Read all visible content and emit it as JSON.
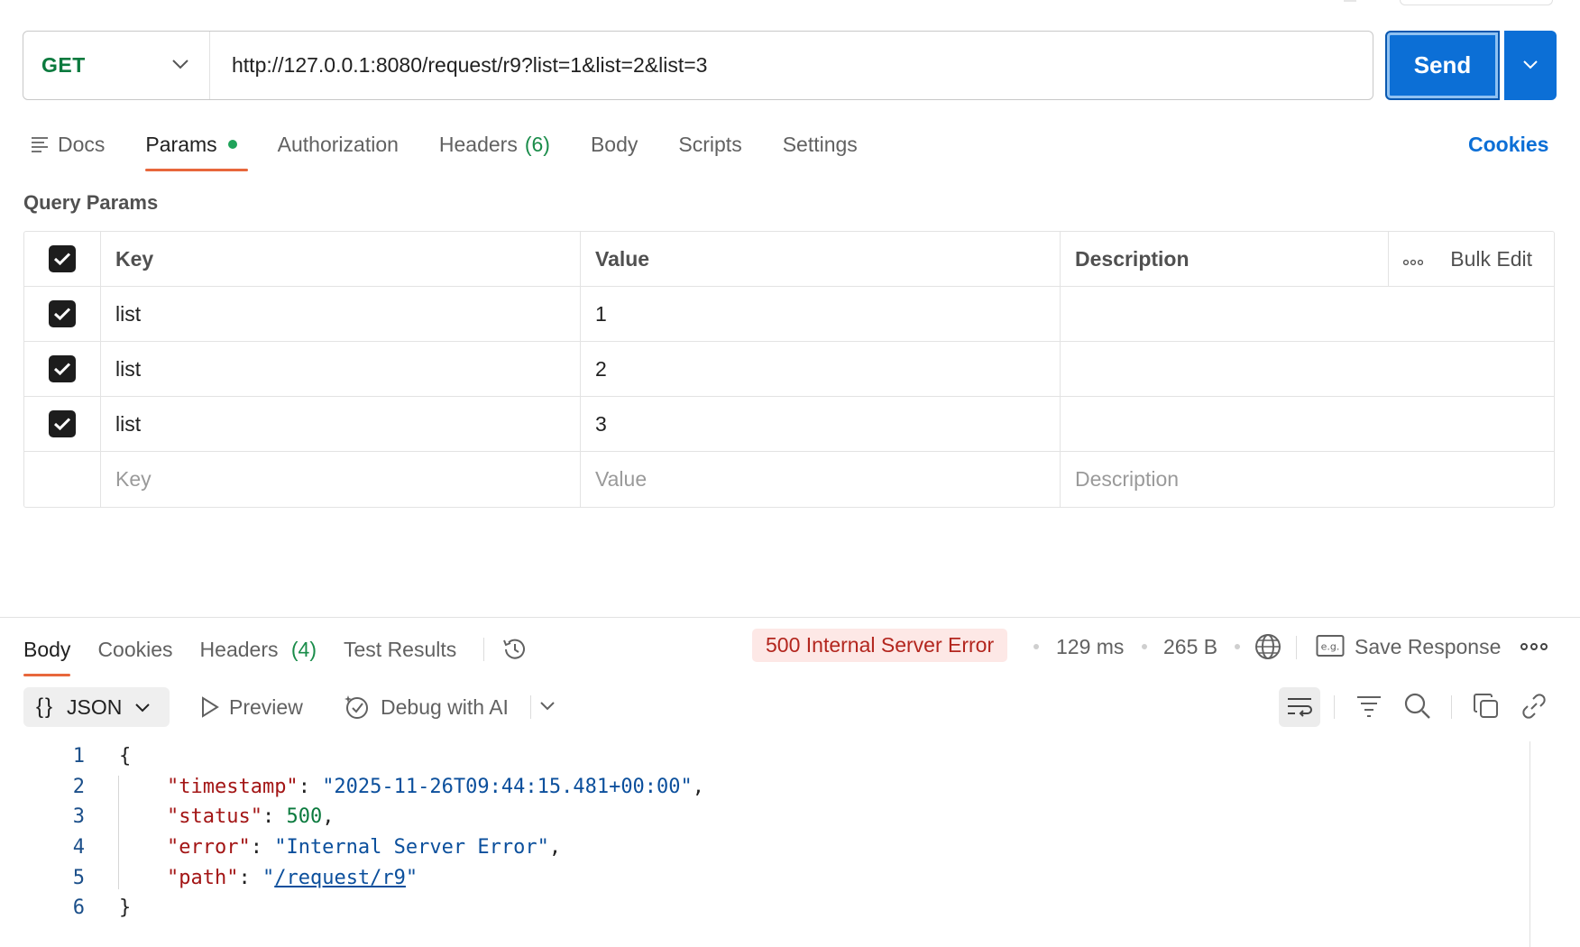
{
  "request": {
    "method": "GET",
    "url": "http://127.0.0.1:8080/request/r9?list=1&list=2&list=3",
    "send_label": "Send"
  },
  "request_tabs": [
    {
      "label": "Docs"
    },
    {
      "label": "Params",
      "active": true,
      "indicator": "green-dot"
    },
    {
      "label": "Authorization"
    },
    {
      "label": "Headers",
      "count": "(6)"
    },
    {
      "label": "Body"
    },
    {
      "label": "Scripts"
    },
    {
      "label": "Settings"
    }
  ],
  "cookies_link": "Cookies",
  "query_params": {
    "title": "Query Params",
    "headers": {
      "key": "Key",
      "value": "Value",
      "description": "Description",
      "bulk_edit": "Bulk Edit"
    },
    "rows": [
      {
        "checked": true,
        "key": "list",
        "value": "1",
        "description": ""
      },
      {
        "checked": true,
        "key": "list",
        "value": "2",
        "description": ""
      },
      {
        "checked": true,
        "key": "list",
        "value": "3",
        "description": ""
      }
    ],
    "placeholders": {
      "key": "Key",
      "value": "Value",
      "description": "Description"
    }
  },
  "response_tabs": [
    {
      "label": "Body",
      "active": true
    },
    {
      "label": "Cookies"
    },
    {
      "label": "Headers",
      "count": "(4)"
    },
    {
      "label": "Test Results"
    }
  ],
  "response_meta": {
    "status": "500 Internal Server Error",
    "time": "129 ms",
    "size": "265 B",
    "save_label": "Save Response"
  },
  "response_toolbar": {
    "format": "JSON",
    "preview": "Preview",
    "debug": "Debug with AI"
  },
  "response_body_lines": [
    {
      "n": "1"
    },
    {
      "n": "2",
      "key": "\"timestamp\"",
      "value": "\"2025-11-26T09:44:15.481+00:00\""
    },
    {
      "n": "3",
      "key": "\"status\"",
      "value": "500"
    },
    {
      "n": "4",
      "key": "\"error\"",
      "value": "\"Internal Server Error\""
    },
    {
      "n": "5",
      "key": "\"path\"",
      "value": "/request/r9"
    },
    {
      "n": "6"
    }
  ],
  "colors": {
    "accent_blue": "#0c6fd6",
    "get_green": "#0b7a3e",
    "tab_underline": "#e8673c",
    "error_bg": "#fde8e6",
    "error_text": "#b3261e"
  },
  "icons": [
    "chevron-down-icon",
    "docs-icon",
    "more-icon",
    "check-icon",
    "history-icon",
    "globe-icon",
    "example-icon",
    "play-icon",
    "ai-icon",
    "wrap-icon",
    "filter-icon",
    "search-icon",
    "copy-icon",
    "link-icon"
  ]
}
